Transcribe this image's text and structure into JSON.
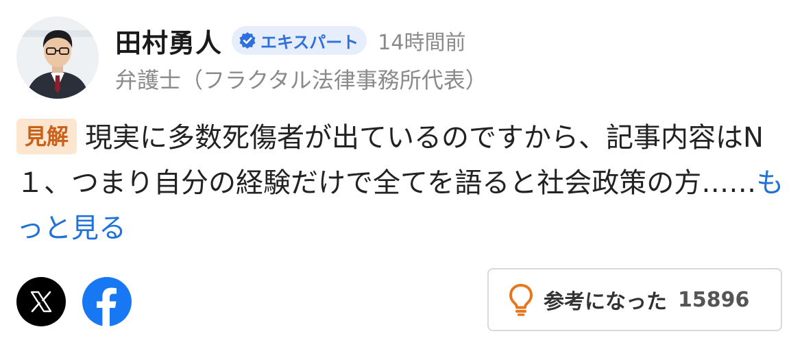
{
  "author": {
    "name": "田村勇人",
    "badge_label": "エキスパート",
    "time_ago": "14時間前",
    "title": "弁護士（フラクタル法律事務所代表）",
    "avatar_icon": "person-photo"
  },
  "comment": {
    "tag": "見解",
    "text": "現実に多数死傷者が出ているのですから、記事内容はN１、つまり自分の経験だけで全てを語ると社会政策の方……",
    "read_more": "もっと見る"
  },
  "share": {
    "x_icon": "x-logo-icon",
    "facebook_icon": "facebook-logo-icon"
  },
  "helpful": {
    "label": "参考になった",
    "count": "15896"
  },
  "colors": {
    "badge_bg": "#e6eefb",
    "badge_text": "#2f6fde",
    "tag_bg": "#fde6cf",
    "tag_text": "#c8611a",
    "link": "#1f72d8",
    "bulb": "#e8761c",
    "facebook": "#1877f2"
  }
}
